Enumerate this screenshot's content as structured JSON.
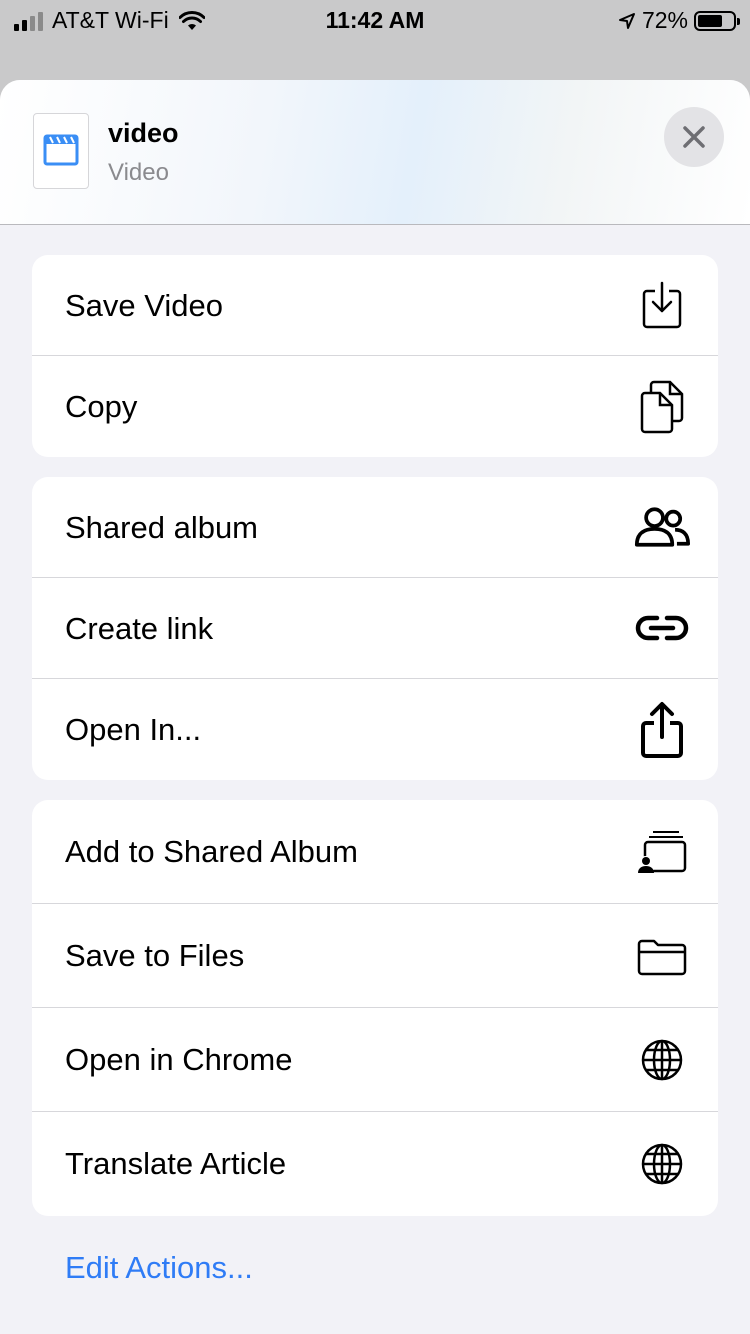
{
  "status_bar": {
    "carrier": "AT&T Wi-Fi",
    "time": "11:42 AM",
    "battery": "72%",
    "battery_level": 0.72
  },
  "header": {
    "title": "video",
    "subtitle": "Video",
    "thumb_icon": "video-clapper-icon",
    "close_icon": "close-icon"
  },
  "groups": [
    [
      {
        "label": "Save Video",
        "icon": "save-download-icon"
      },
      {
        "label": "Copy",
        "icon": "copy-icon"
      }
    ],
    [
      {
        "label": "Shared album",
        "icon": "people-icon"
      },
      {
        "label": "Create link",
        "icon": "link-icon"
      },
      {
        "label": "Open In...",
        "icon": "share-icon"
      }
    ],
    [
      {
        "label": "Add to Shared Album",
        "icon": "shared-album-icon"
      },
      {
        "label": "Save to Files",
        "icon": "folder-icon"
      },
      {
        "label": "Open in Chrome",
        "icon": "globe-icon"
      },
      {
        "label": "Translate Article",
        "icon": "globe-icon"
      }
    ]
  ],
  "footer": {
    "edit_actions": "Edit Actions...",
    "accent": "#2f7cf6"
  }
}
